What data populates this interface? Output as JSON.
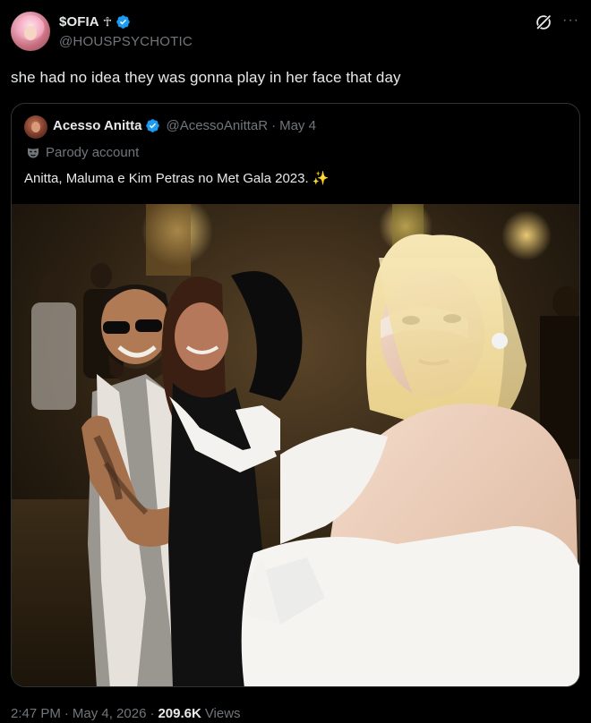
{
  "author": {
    "display_name": "$OFIA",
    "name_glyph": "☥",
    "handle": "@HOUSPSYCHOTIC",
    "avatar_icon": "avatar-pink-hair",
    "verified": true
  },
  "tweet": {
    "text": "she had no idea they was gonna play in her face that day"
  },
  "header_icons": {
    "grok": "grok-icon",
    "more": "···"
  },
  "quote": {
    "display_name": "Acesso Anitta",
    "handle": "@AcessoAnittaR",
    "separator": "·",
    "date": "May 4",
    "label": "Parody account",
    "text": "Anitta, Maluma e Kim Petras no Met Gala 2023.",
    "emoji": "✨",
    "image_alt": "photo-met-gala"
  },
  "footer": {
    "time": "2:47 PM",
    "sep1": "·",
    "date": "May 4, 2026",
    "sep2": "·",
    "views_count": "209.6K",
    "views_label": "Views"
  },
  "colors": {
    "background": "#000000",
    "text": "#e7e9ea",
    "secondary": "#71767b",
    "verified_blue": "#1d9bf0",
    "border": "#2f3336"
  }
}
